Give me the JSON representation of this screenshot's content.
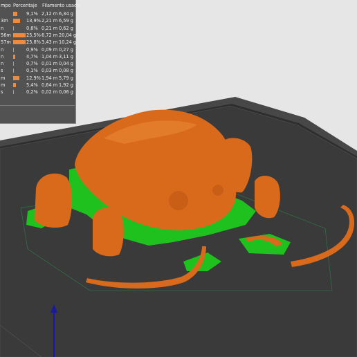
{
  "stats": {
    "headers": {
      "time": "mpo",
      "percent": "Porcentaje",
      "filament": "Filamento usado"
    },
    "rows": [
      {
        "time": "",
        "percent": "9,1%",
        "fraction": 0.091,
        "length": "2,12 m",
        "weight": "6,34 g"
      },
      {
        "time": "3m",
        "percent": "13,9%",
        "fraction": 0.139,
        "length": "2,21 m",
        "weight": "6,59 g"
      },
      {
        "time": "n",
        "percent": "0,8%",
        "fraction": 0.008,
        "length": "0,21 m",
        "weight": "0,62 g"
      },
      {
        "time": "56m",
        "percent": "25,5%",
        "fraction": 0.255,
        "length": "6,72 m",
        "weight": "20,04 g"
      },
      {
        "time": "57m",
        "percent": "25,8%",
        "fraction": 0.258,
        "length": "3,43 m",
        "weight": "10,24 g"
      },
      {
        "time": "n",
        "percent": "0,9%",
        "fraction": 0.009,
        "length": "0,09 m",
        "weight": "0,27 g"
      },
      {
        "time": "n",
        "percent": "4,7%",
        "fraction": 0.047,
        "length": "1,04 m",
        "weight": "3,11 g"
      },
      {
        "time": "n",
        "percent": "0,7%",
        "fraction": 0.007,
        "length": "0,01 m",
        "weight": "0,04 g"
      },
      {
        "time": "s",
        "percent": "0,1%",
        "fraction": 0.001,
        "length": "0,03 m",
        "weight": "0,08 g"
      },
      {
        "time": "m",
        "percent": "12,9%",
        "fraction": 0.129,
        "length": "1,94 m",
        "weight": "5,79 g"
      },
      {
        "time": "m",
        "percent": "5,4%",
        "fraction": 0.054,
        "length": "0,64 m",
        "weight": "1,92 g"
      },
      {
        "time": "s",
        "percent": "0,2%",
        "fraction": 0.002,
        "length": "0,02 m",
        "weight": "0,06 g"
      }
    ],
    "bar_color": "#f08a3c"
  },
  "colors": {
    "background": "#e8e8e8",
    "bed": "#3a3a3a",
    "model_orange": "#d96a1c",
    "support_green": "#1fc11f",
    "axis_z": "#1a1aa0"
  }
}
